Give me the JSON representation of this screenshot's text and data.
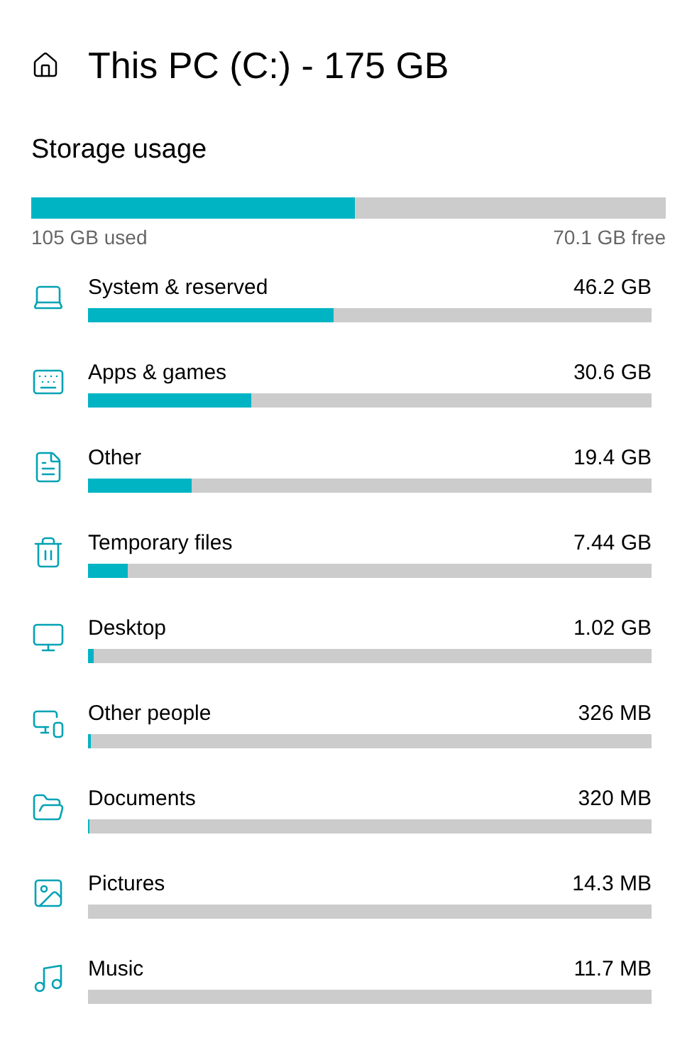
{
  "title": "This PC (C:) - 175 GB",
  "storage": {
    "heading": "Storage usage",
    "level": 0.511,
    "used": "105 GB used",
    "free": "70.1 GB free"
  },
  "categories": [
    {
      "kind": "system",
      "name": "System & reserved",
      "size": "46.2 GB",
      "level": 0.437
    },
    {
      "kind": "apps",
      "name": "Apps & games",
      "size": "30.6 GB",
      "level": 0.289
    },
    {
      "kind": "other",
      "name": "Other",
      "size": "19.4 GB",
      "level": 0.183
    },
    {
      "kind": "temp",
      "name": "Temporary files",
      "size": "7.44 GB",
      "level": 0.07
    },
    {
      "kind": "desktop",
      "name": "Desktop",
      "size": "1.02 GB",
      "level": 0.01
    },
    {
      "kind": "people",
      "name": "Other people",
      "size": "326 MB",
      "level": 0.004
    },
    {
      "kind": "documents",
      "name": "Documents",
      "size": "320 MB",
      "level": 0.003
    },
    {
      "kind": "pictures",
      "name": "Pictures",
      "size": "14.3 MB",
      "level": 0
    },
    {
      "kind": "music",
      "name": "Music",
      "size": "11.7 MB",
      "level": 0
    }
  ]
}
